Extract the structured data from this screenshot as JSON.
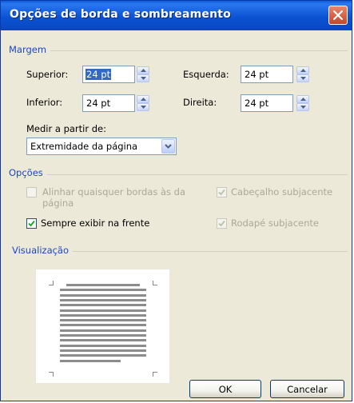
{
  "window": {
    "title": "Opções de borda e sombreamento"
  },
  "margem": {
    "section_label": "Margem",
    "superior_label": "Superior:",
    "superior_value": "24 pt",
    "inferior_label": "Inferior:",
    "inferior_value": "24 pt",
    "esquerda_label": "Esquerda:",
    "esquerda_value": "24 pt",
    "direita_label": "Direita:",
    "direita_value": "24 pt",
    "medir_label": "Medir a partir de:",
    "medir_value": "Extremidade da página"
  },
  "opcoes": {
    "section_label": "Opções",
    "alinhar_label_line1": "Alinhar quaisquer bordas às da",
    "alinhar_label_line2": "página",
    "alinhar_checked": false,
    "sempre_label": "Sempre exibir na frente",
    "sempre_checked": true,
    "cabecalho_label": "Cabeçalho subjacente",
    "cabecalho_checked": true,
    "rodape_label": "Rodapé subjacente",
    "rodape_checked": true
  },
  "visualizacao": {
    "section_label": "Visualização"
  },
  "buttons": {
    "ok_label": "OK",
    "cancel_label": "Cancelar"
  },
  "colors": {
    "title_bar": "#0b53d3",
    "section_label": "#1c48c5",
    "selection": "#316ac5",
    "dialog_bg": "#ece9d8"
  }
}
